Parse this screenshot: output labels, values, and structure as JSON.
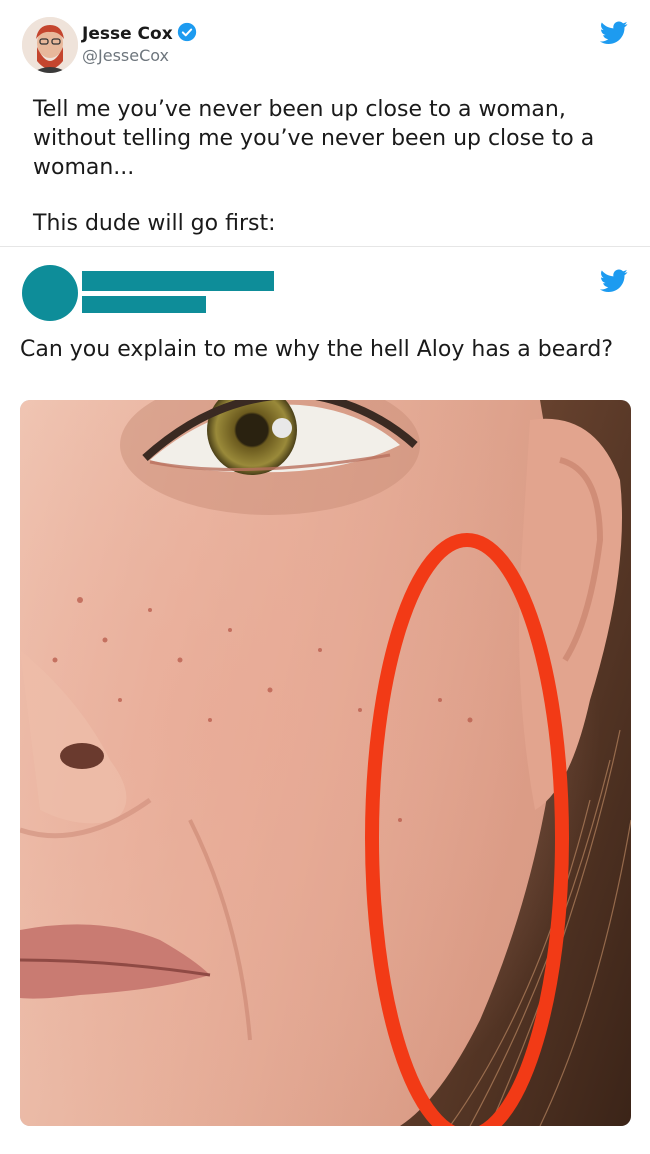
{
  "tweet1": {
    "author_name": "Jesse Cox",
    "author_handle": "@JesseCox",
    "verified": true,
    "text_line1": "Tell me you’ve never been up close to a woman, without telling me you’ve never been up close to a woman...",
    "text_line2": "This dude will go first:"
  },
  "tweet2": {
    "author_name_redacted": true,
    "text": "Can you explain to me why the hell Aloy has a beard?",
    "image": {
      "annotation": "red-ellipse-circling-cheek"
    }
  },
  "colors": {
    "twitter_blue": "#1d9bf0",
    "redaction_teal": "#0e8d99",
    "annotation_red": "#f23a16",
    "text": "#1a1a1a",
    "handle_gray": "#6e767d"
  },
  "icons": {
    "brand": "twitter-bird-icon",
    "verified": "verified-badge-icon"
  }
}
